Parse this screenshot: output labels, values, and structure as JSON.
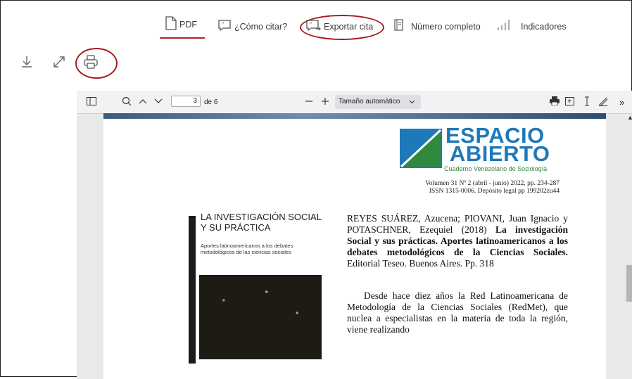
{
  "tabs": [
    {
      "label": "PDF",
      "icon": "file-icon"
    },
    {
      "label": "¿Cómo citar?",
      "icon": "quote-icon"
    },
    {
      "label": "Exportar cita",
      "icon": "export-quote-icon"
    },
    {
      "label": "Número completo",
      "icon": "book-icon"
    },
    {
      "label": "Indicadores",
      "icon": "bar-chart-icon"
    }
  ],
  "active_tab": "PDF",
  "tools": [
    {
      "icon": "download-icon"
    },
    {
      "icon": "expand-icon"
    },
    {
      "icon": "print-icon"
    }
  ],
  "viewer": {
    "page_number": "3",
    "page_total": "de 6",
    "zoom": "Tamaño automático"
  },
  "document": {
    "logo_line1": "ESPACIO",
    "logo_line2": "ABIERTO",
    "logo_subtitle": "Cuaderno Venezolano de Sociología",
    "volume": "Volumen 31 Nº 2 (abril - junio) 2022, pp. 234-287",
    "issn": "ISSN 1315-0006. Depósito legal pp 199202zu44",
    "book_title_line1": "LA INVESTIGACIÓN SOCIAL",
    "book_title_line2": "Y SU PRÁCTICA",
    "book_subtitle_line1": "Aportes latinoamericanos a los debates",
    "book_subtitle_line2": "metodológicos de las ciencias sociales",
    "ref_authors": "REYES SUÁREZ, Azucena; PIOVANI, Juan Ignacio y POTASCHNER, Ezequiel (2018)",
    "ref_title": "La investigación Social y sus prácticas. Aportes latinoamericanos a los debates metodológicos de la Ciencias Sociales.",
    "ref_publisher": "Editorial Teseo. Buenos Aires. Pp. 318",
    "body_text": "Desde hace diez años la Red Latinoamericana de Metodología de la Ciencias Sociales (RedMet), que nuclea a especialistas en la materia de toda la región, viene realizando"
  },
  "colors": {
    "accent": "#a51c22",
    "logo_blue": "#1e79b8",
    "logo_green": "#2f8a3e"
  }
}
